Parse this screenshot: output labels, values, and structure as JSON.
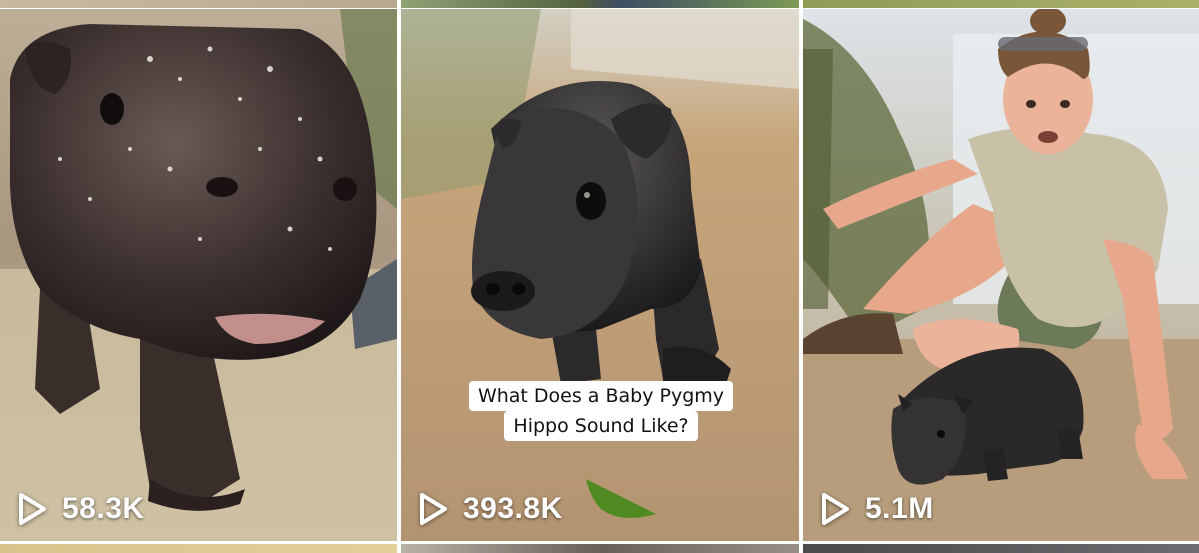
{
  "grid": {
    "tiles": [
      {
        "views": "58.3K",
        "thumbnail": "baby-pygmy-hippo-closeup"
      },
      {
        "views": "393.8K",
        "thumbnail": "baby-pygmy-hippo-standing",
        "caption": {
          "line1": "What Does a Baby Pygmy",
          "line2": "Hippo Sound Like?"
        }
      },
      {
        "views": "5.1M",
        "thumbnail": "zookeeper-with-baby-hippo"
      }
    ]
  },
  "icons": {
    "play": "play-icon"
  },
  "colors": {
    "overlay_text": "#ffffff",
    "caption_bg": "#ffffff",
    "caption_text": "#111111"
  }
}
